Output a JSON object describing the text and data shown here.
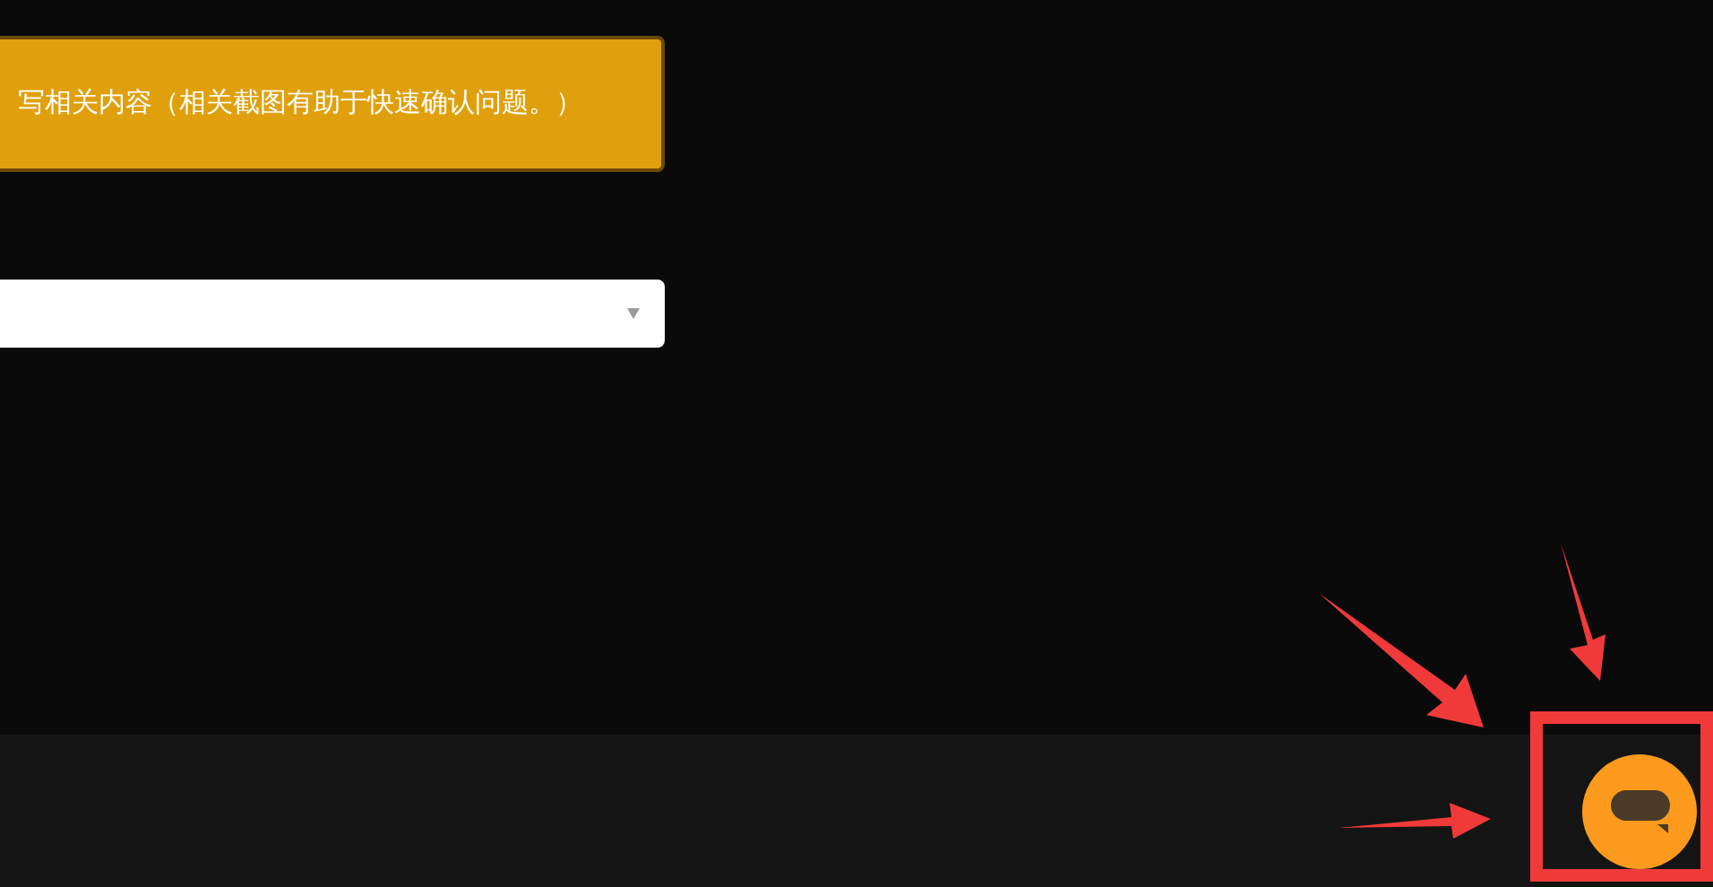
{
  "notice": {
    "text": "写相关内容（相关截图有助于快速确认问题。）"
  },
  "select": {
    "open": false
  }
}
